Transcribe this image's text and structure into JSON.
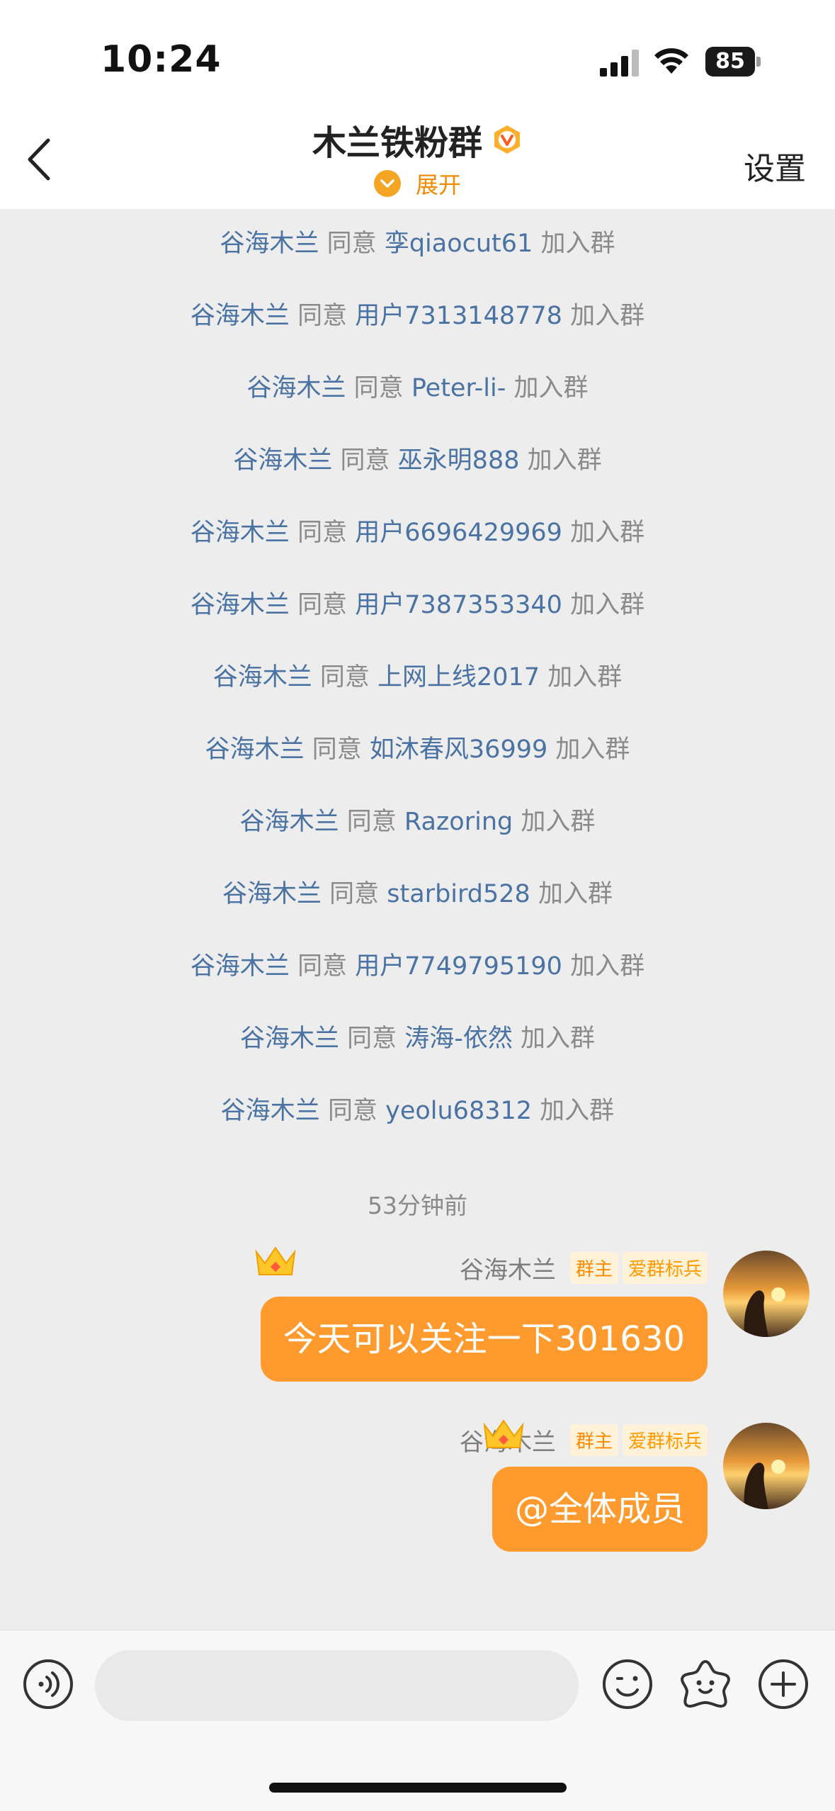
{
  "status_bar": {
    "time": "10:24",
    "battery": "85"
  },
  "header": {
    "title": "木兰铁粉群",
    "expand_label": "展开",
    "settings_label": "设置"
  },
  "system_messages": [
    {
      "actor": "谷海木兰",
      "verb": "同意",
      "target": "孪qiaocut61",
      "tail": "加入群"
    },
    {
      "actor": "谷海木兰",
      "verb": "同意",
      "target": "用户7313148778",
      "tail": "加入群"
    },
    {
      "actor": "谷海木兰",
      "verb": "同意",
      "target": "Peter-li-",
      "tail": "加入群"
    },
    {
      "actor": "谷海木兰",
      "verb": "同意",
      "target": "巫永明888",
      "tail": "加入群"
    },
    {
      "actor": "谷海木兰",
      "verb": "同意",
      "target": "用户6696429969",
      "tail": "加入群"
    },
    {
      "actor": "谷海木兰",
      "verb": "同意",
      "target": "用户7387353340",
      "tail": "加入群"
    },
    {
      "actor": "谷海木兰",
      "verb": "同意",
      "target": "上网上线2017",
      "tail": "加入群"
    },
    {
      "actor": "谷海木兰",
      "verb": "同意",
      "target": "如沐春风36999",
      "tail": "加入群"
    },
    {
      "actor": "谷海木兰",
      "verb": "同意",
      "target": "Razoring",
      "tail": "加入群"
    },
    {
      "actor": "谷海木兰",
      "verb": "同意",
      "target": "starbird528",
      "tail": "加入群"
    },
    {
      "actor": "谷海木兰",
      "verb": "同意",
      "target": "用户7749795190",
      "tail": "加入群"
    },
    {
      "actor": "谷海木兰",
      "verb": "同意",
      "target": "涛海-依然",
      "tail": "加入群"
    },
    {
      "actor": "谷海木兰",
      "verb": "同意",
      "target": "yeolu68312",
      "tail": "加入群"
    }
  ],
  "timestamp": "53分钟前",
  "messages": [
    {
      "sender": "谷海木兰",
      "badge_owner": "群主",
      "badge_honor": "爱群标兵",
      "text": "今天可以关注一下301630"
    },
    {
      "sender": "谷海木兰",
      "badge_owner": "群主",
      "badge_honor": "爱群标兵",
      "text": "@全体成员"
    }
  ],
  "input": {
    "placeholder": ""
  },
  "colors": {
    "accent": "#ff9b2e",
    "link_blue": "#4a73a3",
    "muted": "#8a8a8a"
  }
}
